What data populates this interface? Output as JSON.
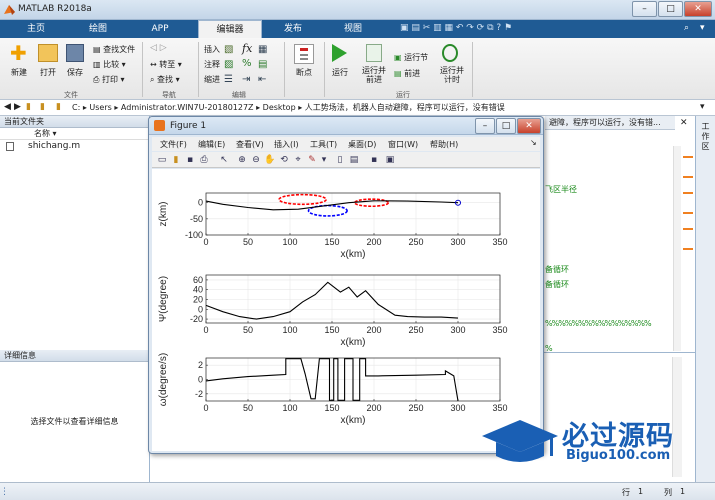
{
  "app": {
    "title": "MATLAB R2018a",
    "controls": {
      "minimize": "–",
      "maximize": "□",
      "close": "✕"
    }
  },
  "tabs": [
    {
      "label": "主页"
    },
    {
      "label": "绘图"
    },
    {
      "label": "APP"
    },
    {
      "label": "编辑器",
      "active": true
    },
    {
      "label": "发布"
    },
    {
      "label": "视图"
    }
  ],
  "search": {
    "placeholder": "搜索文档"
  },
  "ribbon": {
    "file": {
      "new": "新建",
      "open": "打开",
      "save": "保存",
      "find_files": "查找文件",
      "compare": "比较",
      "print": "打印",
      "group": "文件"
    },
    "navigate": {
      "goto": "转至",
      "find": "查找",
      "group": "导航"
    },
    "edit": {
      "insert": "插入",
      "comment": "注释",
      "indent": "缩进",
      "fx": "fx",
      "pct": "%",
      "group": "编辑"
    },
    "breakpoints": {
      "label": "断点"
    },
    "run": {
      "run": "运行",
      "run_advance": "运行并\n前进",
      "run_section": "运行节",
      "advance": "前进",
      "run_time": "运行并\n计时",
      "group": "运行"
    }
  },
  "address": {
    "path": [
      "C:",
      "Users",
      "Administrator.WIN7U-20180127Z",
      "Desktop",
      "人工势场法，机器人自动避障，程序可以运行，没有错误"
    ]
  },
  "current_folder": {
    "title": "当前文件夹",
    "col_name": "名称 ▾",
    "files": [
      "shichang.m"
    ]
  },
  "details": {
    "title": "详细信息",
    "message": "选择文件以查看详细信息"
  },
  "editor": {
    "tab_text": "避障，程序可以运行，没有错...",
    "lines": [
      {
        "text": "飞区半径",
        "color": "#1a8a1a"
      },
      {
        "text": "备循环",
        "color": "#1a8a1a"
      },
      {
        "text": "备循环",
        "color": "#1a8a1a"
      },
      {
        "text": "%%%%%%%%%%%%%%%%",
        "color": "#1a8a1a"
      },
      {
        "text": "%",
        "color": "#1a8a1a"
      }
    ]
  },
  "right_strip": {
    "label": "工作区"
  },
  "status": {
    "row_label": "行",
    "row": "1",
    "col_label": "列",
    "col": "1"
  },
  "figure": {
    "title": "Figure 1",
    "menu": [
      "文件(F)",
      "编辑(E)",
      "查看(V)",
      "插入(I)",
      "工具(T)",
      "桌面(D)",
      "窗口(W)",
      "帮助(H)"
    ]
  },
  "chart_data": [
    {
      "type": "line",
      "xlabel": "x(km)",
      "ylabel": "z(km)",
      "xlim": [
        0,
        350
      ],
      "ylim": [
        -100,
        30
      ],
      "xticks": [
        0,
        50,
        100,
        150,
        200,
        250,
        300,
        350
      ],
      "yticks": [
        0,
        -50,
        -100
      ],
      "series": [
        {
          "x": [
            0,
            20,
            50,
            80,
            110,
            140,
            170,
            200,
            240,
            280,
            300
          ],
          "y": [
            5,
            -5,
            -15,
            -22,
            -20,
            -10,
            0,
            6,
            5,
            2,
            0
          ],
          "color": "#000000"
        }
      ],
      "marker": {
        "x": 300,
        "y": 0,
        "color": "#0000cc"
      },
      "obstacles": [
        {
          "cx": 115,
          "cy": 10,
          "rx": 28,
          "ry": 15,
          "color": "#ff0000"
        },
        {
          "cx": 197,
          "cy": 0,
          "rx": 20,
          "ry": 11,
          "color": "#ff0000"
        },
        {
          "cx": 145,
          "cy": -25,
          "rx": 23,
          "ry": 16,
          "color": "#0000ff"
        }
      ]
    },
    {
      "type": "line",
      "xlabel": "x(km)",
      "ylabel": "Ψ(degree)",
      "xlim": [
        0,
        350
      ],
      "ylim": [
        -28,
        70
      ],
      "xticks": [
        0,
        50,
        100,
        150,
        200,
        250,
        300,
        350
      ],
      "yticks": [
        60,
        40,
        20,
        0,
        -20
      ],
      "series": [
        {
          "x": [
            0,
            20,
            40,
            60,
            80,
            100,
            115,
            130,
            145,
            160,
            170,
            180,
            190,
            205,
            225,
            240,
            260,
            280,
            300
          ],
          "y": [
            8,
            -5,
            -15,
            -20,
            -15,
            -5,
            15,
            30,
            55,
            35,
            45,
            25,
            38,
            10,
            -12,
            -15,
            -16,
            -16,
            -18
          ],
          "color": "#000000"
        }
      ]
    },
    {
      "type": "line",
      "xlabel": "x(km)",
      "ylabel": "ω(degree/s)",
      "xlim": [
        0,
        350
      ],
      "ylim": [
        -3,
        3
      ],
      "xticks": [
        0,
        50,
        100,
        150,
        200,
        250,
        300,
        350
      ],
      "yticks": [
        2,
        0,
        -2
      ],
      "series": [
        {
          "x": [
            0,
            20,
            50,
            80,
            95,
            95,
            113,
            118,
            125,
            130,
            135,
            135,
            147,
            147,
            152,
            152,
            157,
            157,
            165,
            165,
            175,
            175,
            183,
            183,
            190,
            190,
            200,
            205,
            250,
            285,
            285,
            295,
            300
          ],
          "y": [
            -0.2,
            0.1,
            0.4,
            0.6,
            0.7,
            2.9,
            2.9,
            0.8,
            -2.7,
            -2.7,
            2.9,
            2.9,
            2.9,
            -2.9,
            -2.9,
            2.9,
            2.9,
            -2.9,
            -2.9,
            2.9,
            2.9,
            -2.9,
            -2.9,
            2.9,
            2.9,
            0.5,
            0.5,
            0.5,
            0.6,
            0.7,
            1.2,
            0.5,
            -3
          ],
          "color": "#000000"
        }
      ]
    }
  ],
  "watermark": {
    "brand": "必过源码",
    "site": "Biguo100.com"
  }
}
